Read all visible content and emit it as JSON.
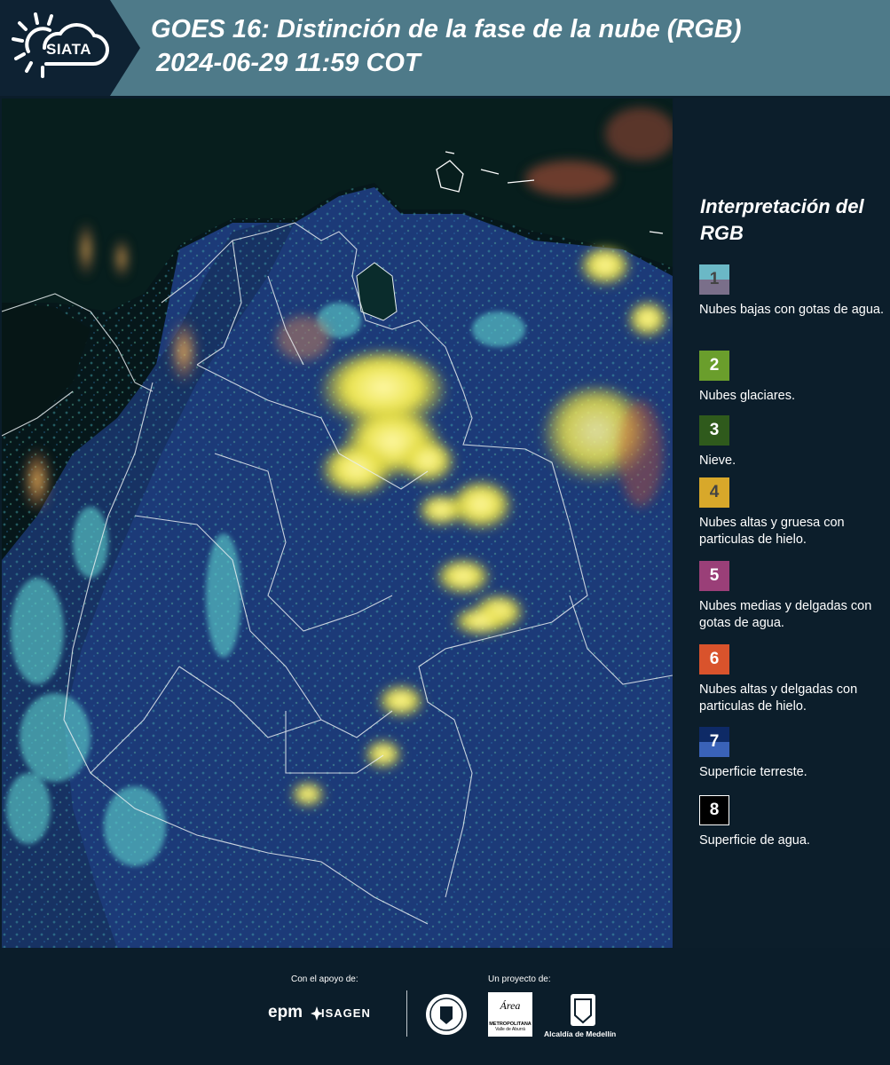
{
  "header": {
    "logo_text": "SIATA",
    "title_line1": "GOES 16: Distinción de la fase de la nube (RGB)",
    "title_line2": "2024-06-29 11:59 COT"
  },
  "legend": {
    "title": "Interpretación del RGB",
    "items": [
      {
        "num": "1",
        "label": "Nubes bajas con gotas de agua.",
        "color_top": "#6bb8c6",
        "color_bottom": "#7a6f8a"
      },
      {
        "num": "2",
        "label": "Nubes glaciares.",
        "color": "#6a9e2c"
      },
      {
        "num": "3",
        "label": "Nieve.",
        "color": "#2f5a1c"
      },
      {
        "num": "4",
        "label": "Nubes altas y gruesa con particulas de hielo.",
        "color": "#d8a82a"
      },
      {
        "num": "5",
        "label": "Nubes medias y delgadas con gotas de agua.",
        "color": "#9a3f78"
      },
      {
        "num": "6",
        "label": "Nubes altas y delgadas con particulas de hielo.",
        "color": "#d9532c"
      },
      {
        "num": "7",
        "label": "Superficie terreste.",
        "color_top": "#0e2a66",
        "color_bottom": "#3a62b8"
      },
      {
        "num": "8",
        "label": "Superficie de agua.",
        "color": "#000000"
      }
    ]
  },
  "footer": {
    "support_label": "Con el apoyo de:",
    "project_label": "Un proyecto de:",
    "sponsor1": "epm",
    "sponsor2": "ISAGEN",
    "partner_area_line1": "Área",
    "partner_area_line2": "METROPOLITANA",
    "partner_area_line3": "Valle de Aburrá",
    "partner_alcaldia": "Alcaldía de Medellín"
  }
}
